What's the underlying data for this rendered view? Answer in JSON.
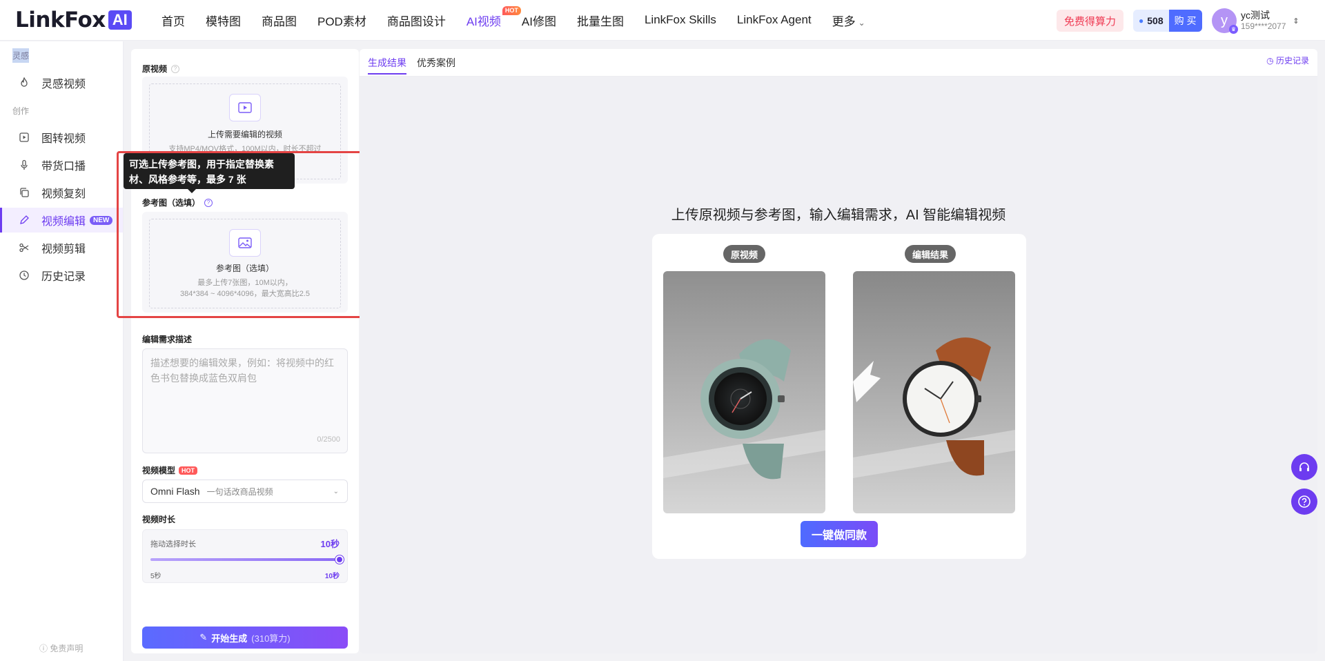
{
  "header": {
    "logo_text": "LinkFox",
    "logo_badge": "AI",
    "nav": [
      {
        "label": "首页"
      },
      {
        "label": "模特图"
      },
      {
        "label": "商品图"
      },
      {
        "label": "POD素材"
      },
      {
        "label": "商品图设计"
      },
      {
        "label": "AI视频",
        "badge": "HOT"
      },
      {
        "label": "AI修图"
      },
      {
        "label": "批量生图"
      },
      {
        "label": "LinkFox Skills"
      },
      {
        "label": "LinkFox Agent"
      },
      {
        "label": "更多"
      }
    ],
    "free_btn": "免费得算力",
    "points": "508",
    "buy": "购 买",
    "user": {
      "avatar": "y",
      "name": "yc测试",
      "phone": "159****2077"
    }
  },
  "sidebar": {
    "section_inspire": "灵感",
    "section_create": "创作",
    "items": [
      {
        "label": "灵感视频",
        "icon": "flame-icon"
      },
      {
        "label": "图转视频",
        "icon": "play-square-icon"
      },
      {
        "label": "带货口播",
        "icon": "microphone-icon"
      },
      {
        "label": "视频复刻",
        "icon": "copy-icon"
      },
      {
        "label": "视频编辑",
        "icon": "pencil-icon",
        "badge": "NEW"
      },
      {
        "label": "视频剪辑",
        "icon": "scissors-icon"
      },
      {
        "label": "历史记录",
        "icon": "clock-icon"
      }
    ],
    "footer": "免责声明"
  },
  "form": {
    "source_video": {
      "label": "原视频",
      "upload_title": "上传需要编辑的视频",
      "upload_hint": "支持MP4/MOV格式，100M以内，时长不超过"
    },
    "tooltip": "可选上传参考图，用于指定替换素材、风格参考等，最多 7 张",
    "reference": {
      "label": "参考图（选填）",
      "upload_title": "参考图（选填）",
      "hint_line1": "最多上传7张图，10M以内，",
      "hint_line2": "384*384 ~ 4096*4096，最大宽高比2.5"
    },
    "description": {
      "label": "编辑需求描述",
      "placeholder": "描述想要的编辑效果，例如：将视频中的红色书包替换成蓝色双肩包",
      "count": "0/2500"
    },
    "model": {
      "label": "视频模型",
      "badge": "HOT",
      "value": "Omni Flash",
      "sub": "一句话改商品视频"
    },
    "duration": {
      "label": "视频时长",
      "hint": "拖动选择时长",
      "value": "10秒",
      "min": "5秒",
      "max": "10秒",
      "fraction": 1.0
    },
    "generate": {
      "label": "开始生成",
      "cost": "(310算力)"
    }
  },
  "result": {
    "tabs": [
      {
        "label": "生成结果"
      },
      {
        "label": "优秀案例"
      }
    ],
    "history": "历史记录",
    "demo_title": "上传原视频与参考图，输入编辑需求，AI 智能编辑视频",
    "before_label": "原视频",
    "after_label": "编辑结果",
    "cta": "一键做同款"
  },
  "colors": {
    "accent": "#6d3cf0",
    "highlight_border": "#e44444",
    "free_btn_text": "#ef3a53"
  }
}
